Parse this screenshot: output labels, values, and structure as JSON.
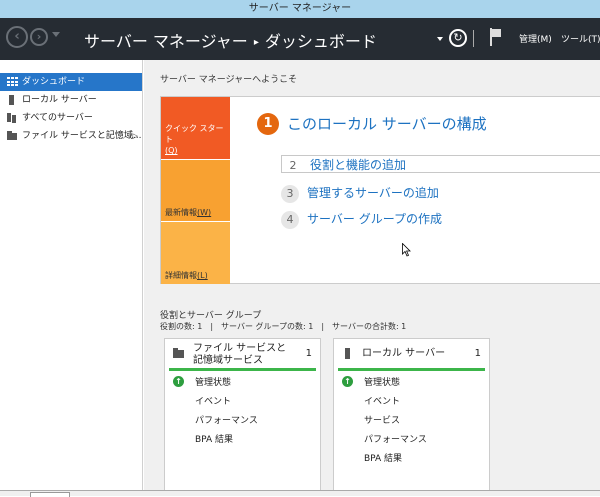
{
  "window": {
    "title": "サーバー マネージャー"
  },
  "header": {
    "breadcrumb_root": "サーバー マネージャー",
    "breadcrumb_sep": "▸",
    "breadcrumb_page": "ダッシュボード",
    "menu_manage": "管理(M)",
    "menu_tools": "ツール(T)"
  },
  "sidebar": {
    "items": [
      {
        "label": "ダッシュボード",
        "selected": true
      },
      {
        "label": "ローカル サーバー"
      },
      {
        "label": "すべてのサーバー"
      },
      {
        "label": "ファイル サービスと記憶域...",
        "expand": "▷"
      }
    ]
  },
  "main": {
    "welcome": "サーバー マネージャーへようこそ",
    "tiles": {
      "quick_start": "クイック スタート",
      "quick_start_key": "(Q)",
      "whats_new": "最新情報",
      "whats_new_key": "(W)",
      "learn_more": "詳細情報",
      "learn_more_key": "(L)"
    },
    "configure": {
      "number": "1",
      "title": "このローカル サーバーの構成"
    },
    "steps": [
      {
        "number": "2",
        "label": "役割と機能の追加"
      },
      {
        "number": "3",
        "label": "管理するサーバーの追加"
      },
      {
        "number": "4",
        "label": "サーバー グループの作成"
      }
    ],
    "roles": {
      "title": "役割とサーバー グループ",
      "summary": "役割の数: 1　|　サーバー グループの数: 1　|　サーバーの合計数: 1"
    },
    "cards": [
      {
        "title": "ファイル サービスと記憶域サービス",
        "count": "1",
        "status_color": "#3cb54a",
        "rows": [
          "管理状態",
          "イベント",
          "パフォーマンス",
          "BPA 結果"
        ]
      },
      {
        "title": "ローカル サーバー",
        "count": "1",
        "status_color": "#3cb54a",
        "rows": [
          "管理状態",
          "イベント",
          "サービス",
          "パフォーマンス",
          "BPA 結果"
        ]
      }
    ]
  },
  "colors": {
    "accent": "#1d72c1",
    "header_bg": "#262c33",
    "tile_quick": "#f15a24",
    "tile_new": "#f8a131",
    "tile_more": "#fbb347"
  },
  "icons": [
    "back-arrow-icon",
    "forward-arrow-icon",
    "refresh-icon",
    "flag-icon",
    "dashboard-icon",
    "server-icon",
    "all-servers-icon",
    "file-storage-icon",
    "status-ok-icon"
  ]
}
